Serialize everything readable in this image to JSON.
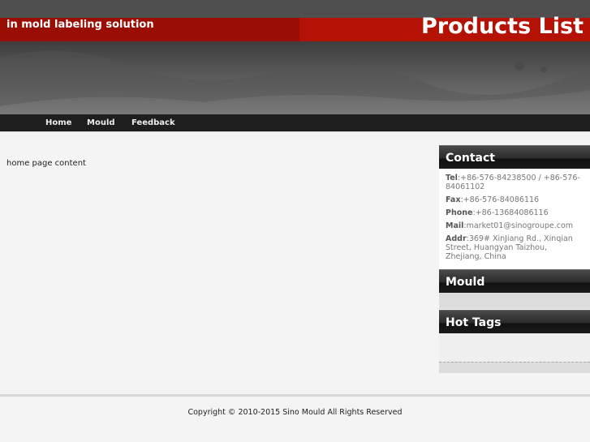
{
  "header": {
    "tagline": "in mold labeling solution",
    "title": "Products List"
  },
  "nav": [
    {
      "label": "Home"
    },
    {
      "label": "Mould"
    },
    {
      "label": "Feedback"
    }
  ],
  "main": {
    "content": "home page content"
  },
  "sidebar": {
    "contact": {
      "title": "Contact",
      "items": [
        {
          "label": "Tel",
          "value": ":+86-576-84238500 / +86-576-84061102"
        },
        {
          "label": "Fax",
          "value": ":+86-576-84086116"
        },
        {
          "label": "Phone",
          "value": ":+86-13684086116"
        },
        {
          "label": "Mail",
          "value": ":market01@sinogroupe.com"
        },
        {
          "label": "Addr",
          "value": ":369# XinJiang Rd., Xinqian Street, Huangyan Taizhou, Zhejiang, China"
        }
      ]
    },
    "mould": {
      "title": "Mould"
    },
    "hot_tags": {
      "title": "Hot Tags"
    }
  },
  "footer": {
    "copyright": "Copyright © 2010-2015 Sino Mould All Rights Reserved"
  }
}
